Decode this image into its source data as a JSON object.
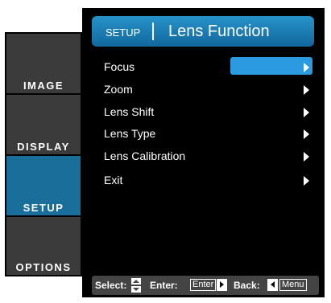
{
  "tabs": [
    {
      "label": "IMAGE",
      "active": false
    },
    {
      "label": "DISPLAY",
      "active": false
    },
    {
      "label": "SETUP",
      "active": true
    },
    {
      "label": "OPTIONS",
      "active": false
    }
  ],
  "header": {
    "section": "SETUP",
    "title": "Lens Function"
  },
  "menu": [
    {
      "label": "Focus",
      "selected": true
    },
    {
      "label": "Zoom",
      "selected": false
    },
    {
      "label": "Lens Shift",
      "selected": false
    },
    {
      "label": "Lens Type",
      "selected": false
    },
    {
      "label": "Lens Calibration",
      "selected": false
    },
    {
      "label": "Exit",
      "selected": false
    }
  ],
  "footer": {
    "select_label": "Select:",
    "enter_label": "Enter:",
    "enter_key": "Enter",
    "back_label": "Back:",
    "back_key": "Menu"
  },
  "colors": {
    "accent": "#2c9ae0",
    "active_tab": "#1a6f9a",
    "tab": "#3b3b3b"
  }
}
